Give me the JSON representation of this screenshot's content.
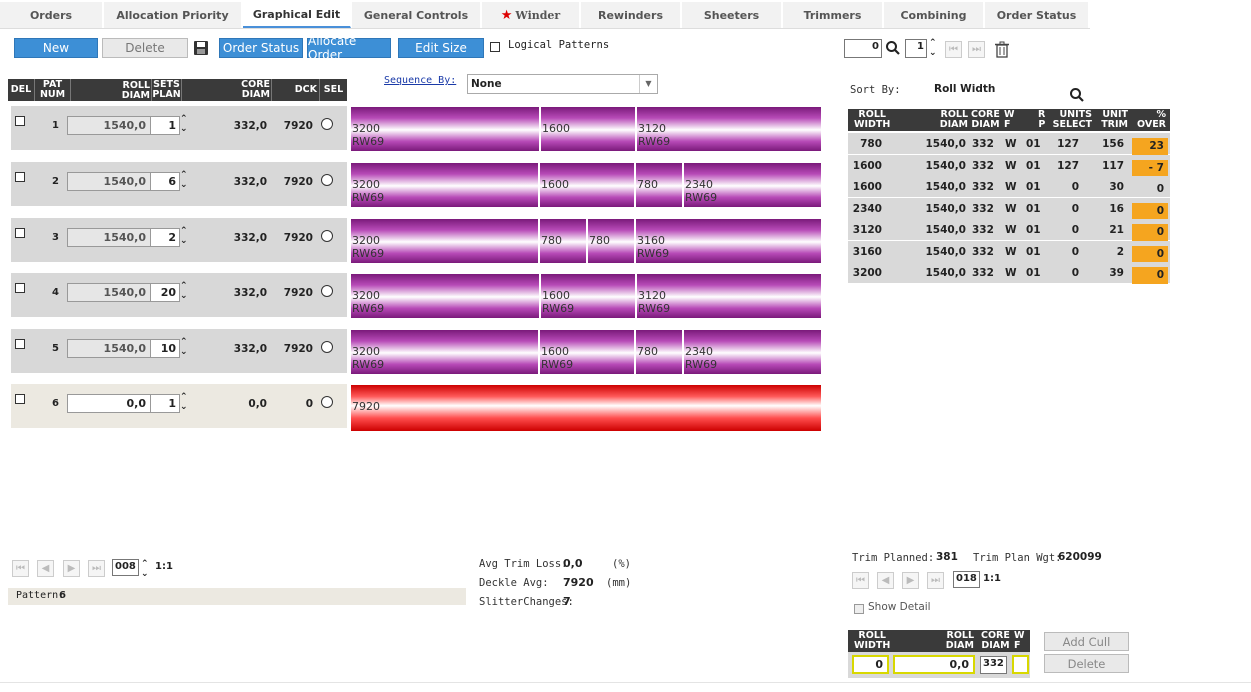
{
  "tabs": [
    "Orders",
    "Allocation Priority",
    "Graphical Edit",
    "General Controls",
    "Winder",
    "Rewinders",
    "Sheeters",
    "Trimmers",
    "Combining",
    "Order Status"
  ],
  "toolbar": {
    "new": "New",
    "delete": "Delete",
    "order_status": "Order Status",
    "allocate_order": "Allocate Order",
    "edit_size": "Edit Size",
    "logical_patterns": "Logical Patterns",
    "sequence_by_label": "Sequence By:",
    "sequence_by_value": "None"
  },
  "grid_header": {
    "del": "DEL",
    "pat": "PAT",
    "num": "NUM",
    "roll": "ROLL",
    "diam": "DIAM",
    "sets": "SETS",
    "plan": "PLAN",
    "core": "CORE",
    "core_diam": "DIAM",
    "dck": "DCK",
    "sel": "SEL"
  },
  "patterns": [
    {
      "num": "1",
      "diam": "1540,0",
      "sets": "1",
      "core": "332,0",
      "dck": "7920"
    },
    {
      "num": "2",
      "diam": "1540,0",
      "sets": "6",
      "core": "332,0",
      "dck": "7920"
    },
    {
      "num": "3",
      "diam": "1540,0",
      "sets": "2",
      "core": "332,0",
      "dck": "7920"
    },
    {
      "num": "4",
      "diam": "1540,0",
      "sets": "20",
      "core": "332,0",
      "dck": "7920"
    },
    {
      "num": "5",
      "diam": "1540,0",
      "sets": "10",
      "core": "332,0",
      "dck": "7920"
    },
    {
      "num": "6",
      "diam": "0,0",
      "sets": "1",
      "core": "0,0",
      "dck": "0"
    }
  ],
  "segments": [
    [
      {
        "w": "3200",
        "rw": "RW69"
      },
      {
        "w": "1600",
        "rw": ""
      },
      {
        "w": "3120",
        "rw": "RW69"
      }
    ],
    [
      {
        "w": "3200",
        "rw": "RW69"
      },
      {
        "w": "1600",
        "rw": ""
      },
      {
        "w": "780",
        "rw": ""
      },
      {
        "w": "2340",
        "rw": "RW69"
      }
    ],
    [
      {
        "w": "3200",
        "rw": "RW69"
      },
      {
        "w": "780",
        "rw": ""
      },
      {
        "w": "780",
        "rw": ""
      },
      {
        "w": "3160",
        "rw": "RW69"
      }
    ],
    [
      {
        "w": "3200",
        "rw": "RW69"
      },
      {
        "w": "1600",
        "rw": "RW69"
      },
      {
        "w": "3120",
        "rw": "RW69"
      }
    ],
    [
      {
        "w": "3200",
        "rw": "RW69"
      },
      {
        "w": "1600",
        "rw": "RW69"
      },
      {
        "w": "780",
        "rw": ""
      },
      {
        "w": "2340",
        "rw": "RW69"
      }
    ],
    [
      {
        "w": "7920",
        "rw": ""
      }
    ]
  ],
  "left_pager": {
    "page": "008",
    "ratio": "1:1"
  },
  "pattern_label": "Pattern:",
  "pattern_value": "6",
  "stats": {
    "avg_trim_loss_label": "Avg Trim Loss:",
    "avg_trim_loss": "0,0",
    "avg_unit": "(%)",
    "deckle_avg_label": "Deckle Avg:",
    "deckle_avg": "7920",
    "deckle_unit": "(mm)",
    "slitter_label": "SlitterChanges:",
    "slitter": "7"
  },
  "right_top": {
    "spin1": "0",
    "spin2": "1"
  },
  "sort_by_label": "Sort By:",
  "sort_by_value": "Roll Width",
  "roll_table_header": {
    "roll": "ROLL",
    "width": "WIDTH",
    "rdiam1": "ROLL",
    "rdiam2": "DIAM",
    "core1": "CORE",
    "core2": "DIAM",
    "wf1": "W",
    "wf2": "F",
    "rp1": "R",
    "rp2": "P",
    "units1": "UNITS",
    "units2": "SELECT",
    "unit1": "UNIT",
    "unit2": "TRIM",
    "pct1": "%",
    "pct2": "OVER"
  },
  "roll_rows": [
    {
      "width": "780",
      "diam": "1540,0",
      "core": "332",
      "wf": "W",
      "rp": "01",
      "units": "127",
      "trim": "156",
      "over": "23",
      "hl": true
    },
    {
      "width": "1600",
      "diam": "1540,0",
      "core": "332",
      "wf": "W",
      "rp": "01",
      "units": "127",
      "trim": "117",
      "over": "- 7",
      "hl": true
    },
    {
      "width": "1600",
      "diam": "1540,0",
      "core": "332",
      "wf": "W",
      "rp": "01",
      "units": "0",
      "trim": "30",
      "over": "0",
      "hl": false
    },
    {
      "width": "2340",
      "diam": "1540,0",
      "core": "332",
      "wf": "W",
      "rp": "01",
      "units": "0",
      "trim": "16",
      "over": "0",
      "hl": true
    },
    {
      "width": "3120",
      "diam": "1540,0",
      "core": "332",
      "wf": "W",
      "rp": "01",
      "units": "0",
      "trim": "21",
      "over": "0",
      "hl": true
    },
    {
      "width": "3160",
      "diam": "1540,0",
      "core": "332",
      "wf": "W",
      "rp": "01",
      "units": "0",
      "trim": "2",
      "over": "0",
      "hl": true
    },
    {
      "width": "3200",
      "diam": "1540,0",
      "core": "332",
      "wf": "W",
      "rp": "01",
      "units": "0",
      "trim": "39",
      "over": "0",
      "hl": true
    }
  ],
  "trim": {
    "planned_label": "Trim Planned:",
    "planned": "381",
    "wgt_label": "Trim Plan Wgt:",
    "wgt": "620099"
  },
  "right_pager": {
    "page": "018",
    "ratio": "1:1"
  },
  "show_detail": "Show Detail",
  "cull_header": {
    "roll": "ROLL",
    "width": "WIDTH",
    "rdiam1": "ROLL",
    "rdiam2": "DIAM",
    "core1": "CORE",
    "core2": "DIAM",
    "wf1": "W",
    "wf2": "F"
  },
  "cull_values": {
    "width": "0",
    "diam": "0,0",
    "core": "332",
    "wf": ""
  },
  "cull_buttons": {
    "add": "Add Cull",
    "delete": "Delete"
  },
  "colors": {
    "accent": "#3d8fd6",
    "pattern": "#b74ab7",
    "new_pattern": "#ff3333",
    "over_highlight": "#f5a51f"
  }
}
